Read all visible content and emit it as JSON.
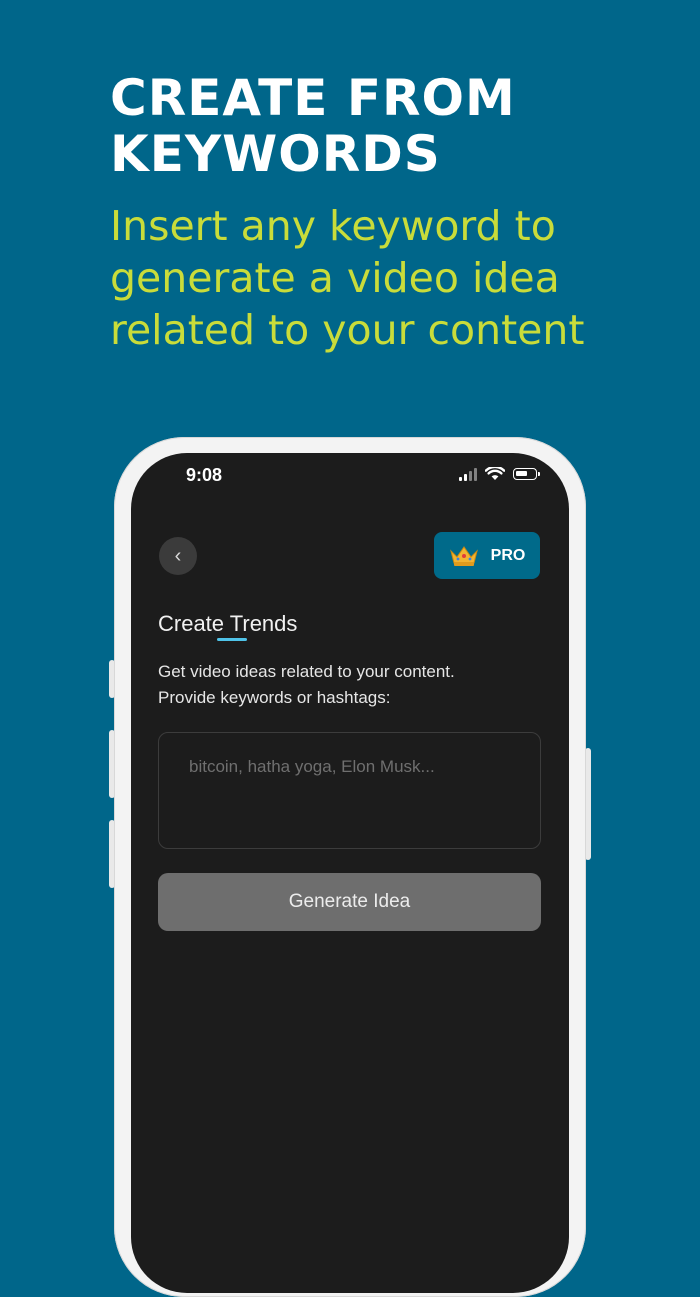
{
  "promo": {
    "headline_line1": "CREATE FROM",
    "headline_line2": "KEYWORDS",
    "subheadline": "Insert any keyword to generate a video idea related to your content"
  },
  "status_bar": {
    "time": "9:08",
    "icons": [
      "cellular-signal-icon",
      "wifi-icon",
      "battery-icon"
    ]
  },
  "header": {
    "back_icon": "chevron-left-icon",
    "pro_badge": {
      "icon": "crown-icon",
      "label": "PRO"
    }
  },
  "main": {
    "title": "Create Trends",
    "description_line1": "Get video ideas related to your content.",
    "description_line2": "Provide keywords or hashtags:",
    "keywords_input": {
      "value": "",
      "placeholder": "bitcoin, hatha yoga, Elon Musk..."
    },
    "generate_button": "Generate Idea"
  },
  "colors": {
    "background": "#00668a",
    "headline": "#ffffff",
    "subheadline": "#c9dc3a",
    "screen": "#1c1c1c",
    "pro_button": "#006a8a",
    "accent_underline": "#4fc3e8",
    "generate_button": "#6e6e6e"
  }
}
